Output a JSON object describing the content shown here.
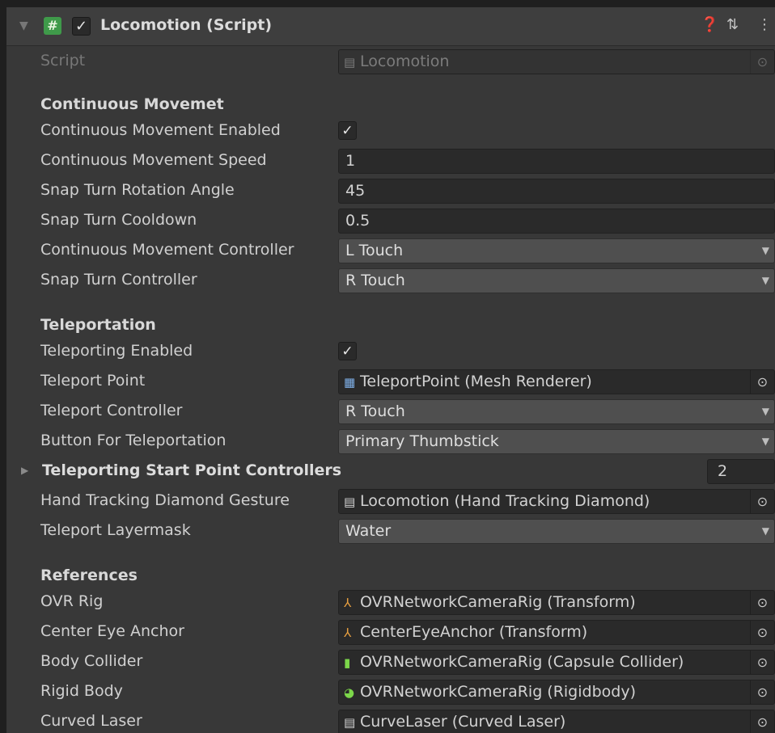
{
  "component": {
    "title": "Locomotion (Script)",
    "enabled_check": "✓",
    "icons": [
      "help-icon",
      "preset-icon",
      "menu-icon"
    ]
  },
  "script": {
    "label": "Script",
    "value": "Locomotion"
  },
  "continuous": {
    "header": "Continuous Movemet",
    "enabled_label": "Continuous Movement Enabled",
    "enabled_check": "✓",
    "speed_label": "Continuous Movement Speed",
    "speed_value": "1",
    "snap_angle_label": "Snap Turn Rotation Angle",
    "snap_angle_value": "45",
    "snap_cooldown_label": "Snap Turn Cooldown",
    "snap_cooldown_value": "0.5",
    "controller_label": "Continuous Movement Controller",
    "controller_value": "L Touch",
    "snap_controller_label": "Snap Turn Controller",
    "snap_controller_value": "R Touch"
  },
  "teleportation": {
    "header": "Teleportation",
    "enabled_label": "Teleporting Enabled",
    "enabled_check": "✓",
    "point_label": "Teleport Point",
    "point_value": "TeleportPoint (Mesh Renderer)",
    "controller_label": "Teleport Controller",
    "controller_value": "R Touch",
    "button_label": "Button For Teleportation",
    "button_value": "Primary Thumbstick",
    "start_points_label": "Teleporting Start Point Controllers",
    "start_points_size": "2",
    "gesture_label": "Hand Tracking Diamond Gesture",
    "gesture_value": "Locomotion (Hand Tracking Diamond)",
    "layermask_label": "Teleport Layermask",
    "layermask_value": "Water"
  },
  "references": {
    "header": "References",
    "ovr_rig_label": "OVR Rig",
    "ovr_rig_value": "OVRNetworkCameraRig (Transform)",
    "center_eye_label": "Center Eye Anchor",
    "center_eye_value": "CenterEyeAnchor (Transform)",
    "body_collider_label": "Body Collider",
    "body_collider_value": "OVRNetworkCameraRig (Capsule Collider)",
    "rigid_body_label": "Rigid Body",
    "rigid_body_value": "OVRNetworkCameraRig (Rigidbody)",
    "curved_laser_label": "Curved Laser",
    "curved_laser_value": "CurveLaser (Curved Laser)"
  },
  "colors": {
    "background": "#383838",
    "field": "#2a2a2a",
    "dropdown": "#4f4f4f",
    "script_icon": "#3f9a4a"
  }
}
